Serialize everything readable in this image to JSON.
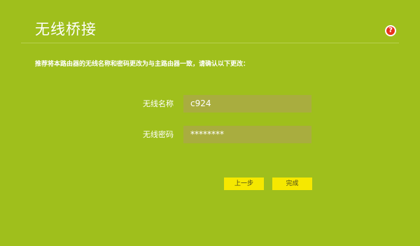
{
  "page": {
    "title": "无线桥接",
    "help_icon": "help-icon",
    "instruction": "推荐将本路由器的无线名称和密码更改为与主路由器一致，请确认以下更改："
  },
  "form": {
    "ssid_label": "无线名称",
    "ssid_value": "c924",
    "password_label": "无线密码",
    "password_value": "********"
  },
  "buttons": {
    "prev_label": "上一步",
    "finish_label": "完成"
  },
  "colors": {
    "background": "#9fbf1c",
    "input_bg": "#a9ad3f",
    "button_bg": "#f6e800",
    "help_red": "#e8331b"
  }
}
